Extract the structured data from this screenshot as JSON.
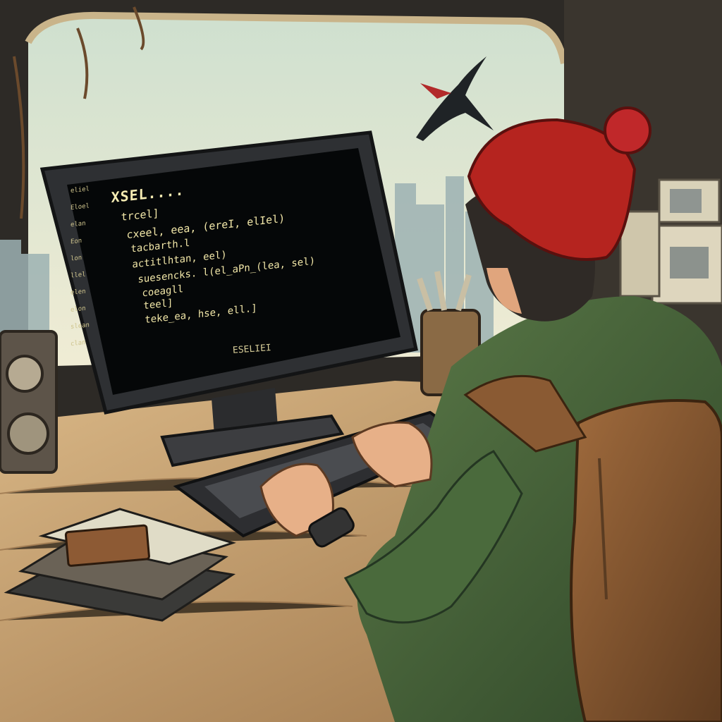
{
  "scene": {
    "description_label": "",
    "colors": {
      "sky": "#e4e9d2",
      "screen": "#050708",
      "screen_text": "#f2e7a8",
      "desk": "#c79e6a",
      "hoodie": "#4c6a3d",
      "beanie": "#b5241f",
      "backpack": "#8a5a33"
    }
  },
  "terminal": {
    "title": "XSEL....",
    "lines": [
      "trcel]",
      "cxeel, eea, (ereI, elIel)",
      "tacbarth.l",
      "actitlhtan, eel)",
      "suesencks. l(el_aPn_(lea, sel)",
      "coeagll",
      "teel]",
      "teke_ea, hse, ell.]"
    ],
    "gutter": [
      "eliel",
      "Eloel",
      "elan",
      "Eon",
      "lon",
      "llel",
      "elen",
      "elon",
      "slean",
      "clan"
    ],
    "taskbar": "ESELIEI"
  }
}
